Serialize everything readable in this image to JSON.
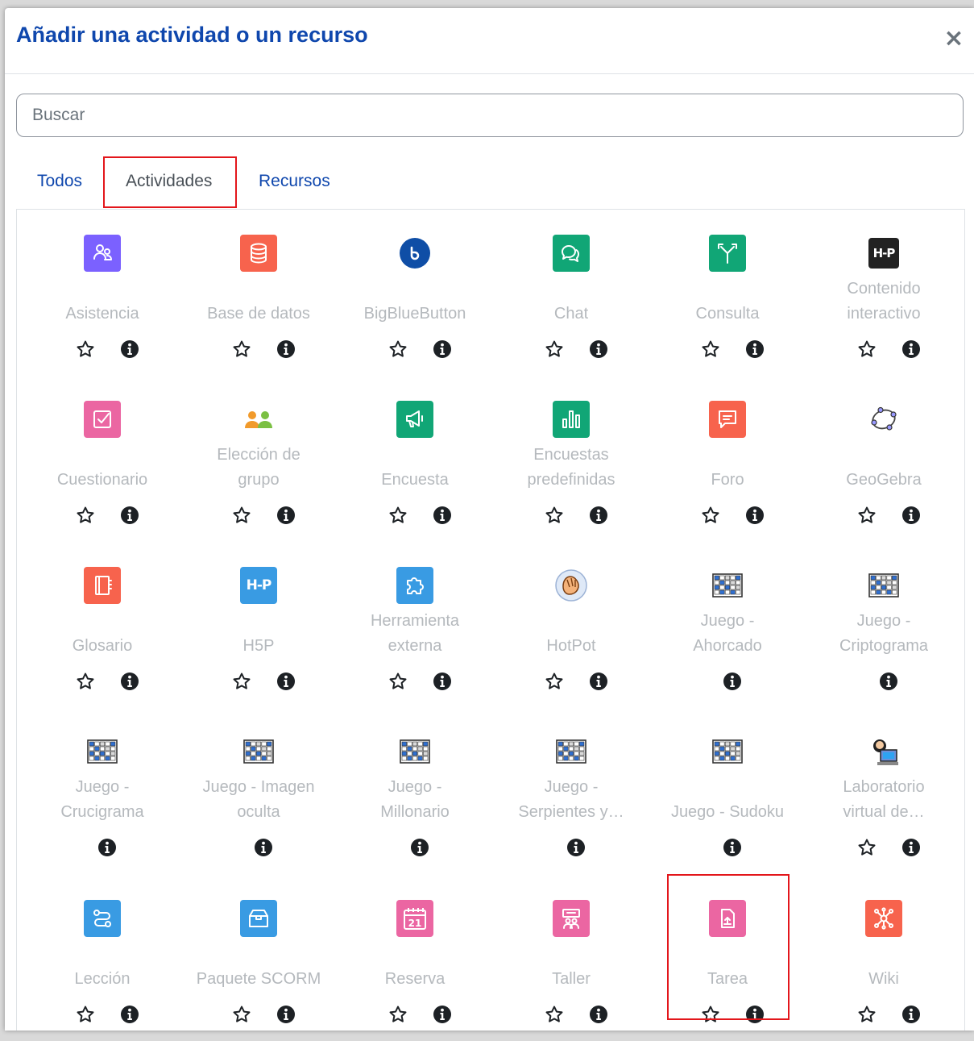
{
  "modal": {
    "title": "Añadir una actividad o un recurso",
    "close_symbol": "×"
  },
  "search": {
    "placeholder": "Buscar",
    "value": ""
  },
  "tabs": [
    {
      "label": "Todos",
      "active": false
    },
    {
      "label": "Actividades",
      "active": true
    },
    {
      "label": "Recursos",
      "active": false
    }
  ],
  "colors": {
    "title": "#0f47ad",
    "label_muted": "#b5b9bd",
    "highlight": "#e3161b"
  },
  "items": [
    {
      "name": "Asistencia",
      "label_lines": [
        "Asistencia"
      ],
      "icon": "attendance-icon",
      "icon_bg": "#7b61ff",
      "favourite": true
    },
    {
      "name": "Base de datos",
      "label_lines": [
        "Base de datos"
      ],
      "icon": "database-icon",
      "icon_bg": "#f7634d",
      "favourite": true
    },
    {
      "name": "BigBlueButton",
      "label_lines": [
        "BigBlueButton"
      ],
      "icon": "bigbluebutton-icon",
      "icon_bg": "#0f4ea6",
      "favourite": true
    },
    {
      "name": "Chat",
      "label_lines": [
        "Chat"
      ],
      "icon": "chat-icon",
      "icon_bg": "#11a676",
      "favourite": true
    },
    {
      "name": "Consulta",
      "label_lines": [
        "Consulta"
      ],
      "icon": "choice-icon",
      "icon_bg": "#11a676",
      "favourite": true
    },
    {
      "name": "Contenido interactivo",
      "label_lines": [
        "Contenido",
        "interactivo"
      ],
      "icon": "h5p-black-icon",
      "icon_bg": "#222222",
      "favourite": true,
      "icon_text": "H5P"
    },
    {
      "name": "Cuestionario",
      "label_lines": [
        "Cuestionario"
      ],
      "icon": "quiz-icon",
      "icon_bg": "#eb66a2",
      "favourite": true
    },
    {
      "name": "Elección de grupo",
      "label_lines": [
        "Elección de",
        "grupo"
      ],
      "icon": "group-choice-icon",
      "icon_bg": "#ffffff",
      "favourite": true
    },
    {
      "name": "Encuesta",
      "label_lines": [
        "Encuesta"
      ],
      "icon": "survey-icon",
      "icon_bg": "#11a676",
      "favourite": true
    },
    {
      "name": "Encuestas predefinidas",
      "label_lines": [
        "Encuestas",
        "predefinidas"
      ],
      "icon": "predefined-survey-icon",
      "icon_bg": "#11a676",
      "favourite": true
    },
    {
      "name": "Foro",
      "label_lines": [
        "Foro"
      ],
      "icon": "forum-icon",
      "icon_bg": "#f7634d",
      "favourite": true
    },
    {
      "name": "GeoGebra",
      "label_lines": [
        "GeoGebra"
      ],
      "icon": "geogebra-icon",
      "icon_bg": "#ffffff",
      "favourite": true
    },
    {
      "name": "Glosario",
      "label_lines": [
        "Glosario"
      ],
      "icon": "glossary-icon",
      "icon_bg": "#f7634d",
      "favourite": true
    },
    {
      "name": "H5P",
      "label_lines": [
        "H5P"
      ],
      "icon": "h5p-icon",
      "icon_bg": "#399be3",
      "favourite": true,
      "icon_text": "H5P"
    },
    {
      "name": "Herramienta externa",
      "label_lines": [
        "Herramienta",
        "externa"
      ],
      "icon": "external-tool-icon",
      "icon_bg": "#399be3",
      "favourite": true
    },
    {
      "name": "HotPot",
      "label_lines": [
        "HotPot"
      ],
      "icon": "hotpot-icon",
      "icon_bg": "#ffffff",
      "favourite": true
    },
    {
      "name": "Juego - Ahorcado",
      "label_lines": [
        "Juego -",
        "Ahorcado"
      ],
      "icon": "game-board-icon",
      "icon_bg": "#ffffff",
      "favourite": false
    },
    {
      "name": "Juego - Criptograma",
      "label_lines": [
        "Juego -",
        "Criptograma"
      ],
      "icon": "game-board-icon",
      "icon_bg": "#ffffff",
      "favourite": false
    },
    {
      "name": "Juego - Crucigrama",
      "label_lines": [
        "Juego -",
        "Crucigrama"
      ],
      "icon": "game-board-icon",
      "icon_bg": "#ffffff",
      "favourite": false
    },
    {
      "name": "Juego - Imagen oculta",
      "label_lines": [
        "Juego - Imagen",
        "oculta"
      ],
      "icon": "game-board-icon",
      "icon_bg": "#ffffff",
      "favourite": false
    },
    {
      "name": "Juego - Millonario",
      "label_lines": [
        "Juego -",
        "Millonario"
      ],
      "icon": "game-board-icon",
      "icon_bg": "#ffffff",
      "favourite": false
    },
    {
      "name": "Juego - Serpientes y…",
      "label_lines": [
        "Juego -",
        "Serpientes y…"
      ],
      "icon": "game-board-icon",
      "icon_bg": "#ffffff",
      "favourite": false
    },
    {
      "name": "Juego - Sudoku",
      "label_lines": [
        "Juego - Sudoku"
      ],
      "icon": "game-board-icon",
      "icon_bg": "#ffffff",
      "favourite": false
    },
    {
      "name": "Laboratorio virtual de…",
      "label_lines": [
        "Laboratorio",
        "virtual de…"
      ],
      "icon": "virtual-lab-icon",
      "icon_bg": "#ffffff",
      "favourite": true
    },
    {
      "name": "Lección",
      "label_lines": [
        "Lección"
      ],
      "icon": "lesson-icon",
      "icon_bg": "#399be3",
      "favourite": true
    },
    {
      "name": "Paquete SCORM",
      "label_lines": [
        "Paquete SCORM"
      ],
      "icon": "scorm-icon",
      "icon_bg": "#399be3",
      "favourite": true
    },
    {
      "name": "Reserva",
      "label_lines": [
        "Reserva"
      ],
      "icon": "calendar-icon",
      "icon_bg": "#eb66a2",
      "favourite": true,
      "icon_text": "21"
    },
    {
      "name": "Taller",
      "label_lines": [
        "Taller"
      ],
      "icon": "workshop-icon",
      "icon_bg": "#eb66a2",
      "favourite": true
    },
    {
      "name": "Tarea",
      "label_lines": [
        "Tarea"
      ],
      "icon": "assignment-icon",
      "icon_bg": "#eb66a2",
      "favourite": true
    },
    {
      "name": "Wiki",
      "label_lines": [
        "Wiki"
      ],
      "icon": "wiki-icon",
      "icon_bg": "#f7634d",
      "favourite": true
    }
  ]
}
